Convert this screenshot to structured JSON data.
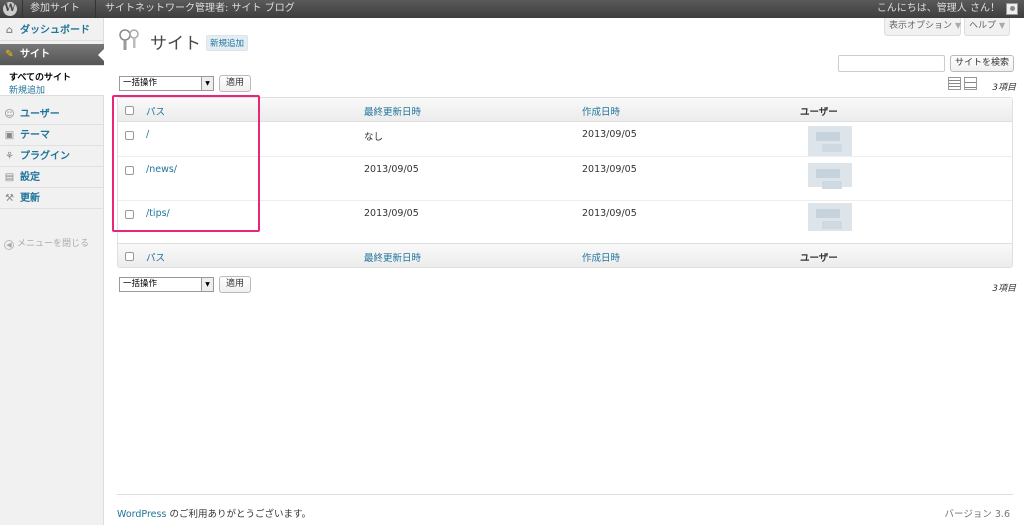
{
  "adminbar": {
    "wp_logo": "wordpress-logo",
    "my_sites": "参加サイト",
    "network_admin": "サイトネットワーク管理者: サイト ブログ",
    "greeting": "こんにちは、管理人 さん！"
  },
  "screen_tabs": {
    "screen_options": "表示オプション",
    "help": "ヘルプ"
  },
  "sidebar": {
    "dashboard": "ダッシュボード",
    "sites": "サイト",
    "sites_sub": [
      "すべてのサイト",
      "新規追加"
    ],
    "users": "ユーザー",
    "themes": "テーマ",
    "plugins": "プラグイン",
    "settings": "設定",
    "updates": "更新",
    "collapse": "メニューを閉じる"
  },
  "page": {
    "title": "サイト",
    "add_new": "新規追加",
    "search_button": "サイトを検索",
    "search_value": "",
    "bulk_action": "一括操作",
    "apply": "適用",
    "item_count": "3項目"
  },
  "table": {
    "headers": [
      "パス",
      "最終更新日時",
      "作成日時",
      "ユーザー"
    ],
    "rows": [
      {
        "path": "/",
        "last_updated": "なし",
        "registered": "2013/09/05"
      },
      {
        "path": "/news/",
        "last_updated": "2013/09/05",
        "registered": "2013/09/05"
      },
      {
        "path": "/tips/",
        "last_updated": "2013/09/05",
        "registered": "2013/09/05"
      }
    ]
  },
  "footer": {
    "wordpress_link": "WordPress",
    "thanks": " のご利用ありがとうございます。",
    "version": "バージョン 3.6"
  },
  "colors": {
    "link": "#21759b",
    "highlight": "#e8267a",
    "adminbar": "#464646"
  }
}
